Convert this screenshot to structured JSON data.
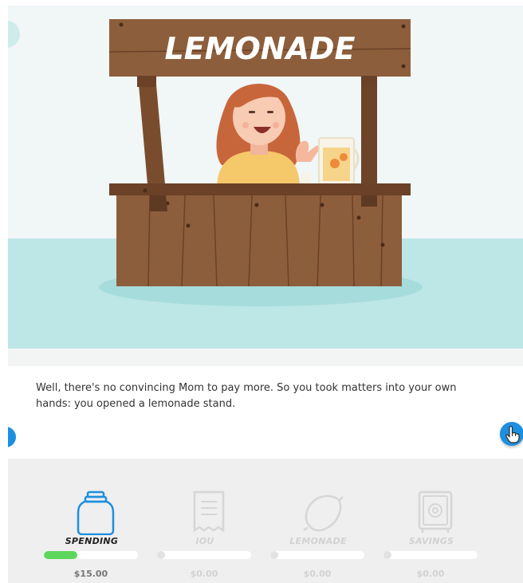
{
  "scene": {
    "sign_text": "LEMONADE"
  },
  "story": {
    "text": "Well, there's no convincing Mom to pay more. So you took matters into your own hands: you opened a lemonade stand."
  },
  "stats": [
    {
      "label": "SPENDING",
      "value": "$15.00",
      "progress": 0.36,
      "active": true,
      "icon": "jar-icon"
    },
    {
      "label": "IOU",
      "value": "$0.00",
      "progress": 0.0,
      "active": false,
      "icon": "receipt-icon"
    },
    {
      "label": "LEMONADE",
      "value": "$0.00",
      "progress": 0.0,
      "active": false,
      "icon": "lemon-icon"
    },
    {
      "label": "SAVINGS",
      "value": "$0.00",
      "progress": 0.0,
      "active": false,
      "icon": "safe-icon"
    }
  ],
  "colors": {
    "accent": "#1d8fe0",
    "progress_fill": "#5cd65c",
    "active_text": "#222222",
    "inactive_text": "#d2d2d2",
    "water": "#bde6e6",
    "wood": "#8d5e3c"
  }
}
